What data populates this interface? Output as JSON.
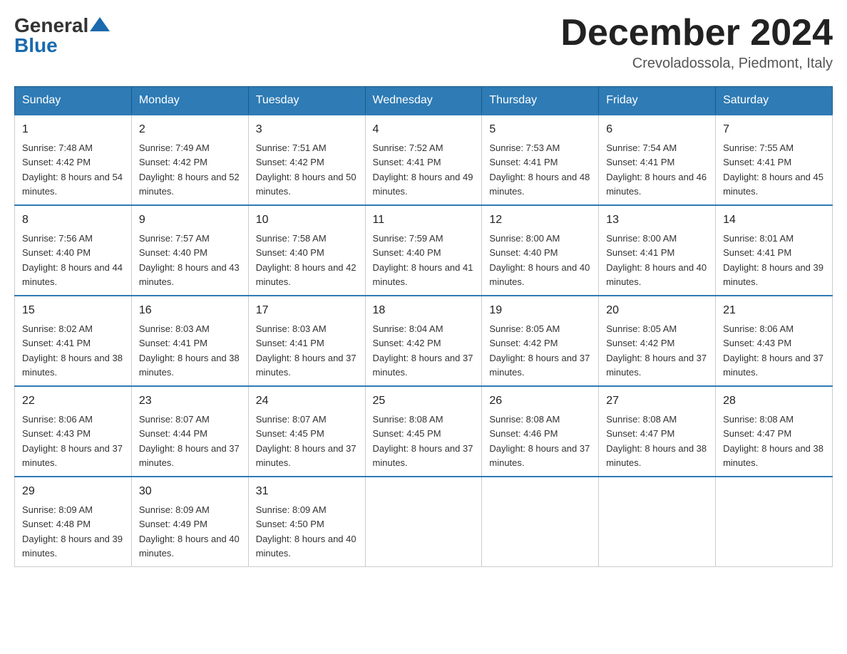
{
  "logo": {
    "general": "General",
    "blue": "Blue"
  },
  "title": "December 2024",
  "location": "Crevoladossola, Piedmont, Italy",
  "days_of_week": [
    "Sunday",
    "Monday",
    "Tuesday",
    "Wednesday",
    "Thursday",
    "Friday",
    "Saturday"
  ],
  "weeks": [
    [
      {
        "day": "1",
        "sunrise": "7:48 AM",
        "sunset": "4:42 PM",
        "daylight": "8 hours and 54 minutes."
      },
      {
        "day": "2",
        "sunrise": "7:49 AM",
        "sunset": "4:42 PM",
        "daylight": "8 hours and 52 minutes."
      },
      {
        "day": "3",
        "sunrise": "7:51 AM",
        "sunset": "4:42 PM",
        "daylight": "8 hours and 50 minutes."
      },
      {
        "day": "4",
        "sunrise": "7:52 AM",
        "sunset": "4:41 PM",
        "daylight": "8 hours and 49 minutes."
      },
      {
        "day": "5",
        "sunrise": "7:53 AM",
        "sunset": "4:41 PM",
        "daylight": "8 hours and 48 minutes."
      },
      {
        "day": "6",
        "sunrise": "7:54 AM",
        "sunset": "4:41 PM",
        "daylight": "8 hours and 46 minutes."
      },
      {
        "day": "7",
        "sunrise": "7:55 AM",
        "sunset": "4:41 PM",
        "daylight": "8 hours and 45 minutes."
      }
    ],
    [
      {
        "day": "8",
        "sunrise": "7:56 AM",
        "sunset": "4:40 PM",
        "daylight": "8 hours and 44 minutes."
      },
      {
        "day": "9",
        "sunrise": "7:57 AM",
        "sunset": "4:40 PM",
        "daylight": "8 hours and 43 minutes."
      },
      {
        "day": "10",
        "sunrise": "7:58 AM",
        "sunset": "4:40 PM",
        "daylight": "8 hours and 42 minutes."
      },
      {
        "day": "11",
        "sunrise": "7:59 AM",
        "sunset": "4:40 PM",
        "daylight": "8 hours and 41 minutes."
      },
      {
        "day": "12",
        "sunrise": "8:00 AM",
        "sunset": "4:40 PM",
        "daylight": "8 hours and 40 minutes."
      },
      {
        "day": "13",
        "sunrise": "8:00 AM",
        "sunset": "4:41 PM",
        "daylight": "8 hours and 40 minutes."
      },
      {
        "day": "14",
        "sunrise": "8:01 AM",
        "sunset": "4:41 PM",
        "daylight": "8 hours and 39 minutes."
      }
    ],
    [
      {
        "day": "15",
        "sunrise": "8:02 AM",
        "sunset": "4:41 PM",
        "daylight": "8 hours and 38 minutes."
      },
      {
        "day": "16",
        "sunrise": "8:03 AM",
        "sunset": "4:41 PM",
        "daylight": "8 hours and 38 minutes."
      },
      {
        "day": "17",
        "sunrise": "8:03 AM",
        "sunset": "4:41 PM",
        "daylight": "8 hours and 37 minutes."
      },
      {
        "day": "18",
        "sunrise": "8:04 AM",
        "sunset": "4:42 PM",
        "daylight": "8 hours and 37 minutes."
      },
      {
        "day": "19",
        "sunrise": "8:05 AM",
        "sunset": "4:42 PM",
        "daylight": "8 hours and 37 minutes."
      },
      {
        "day": "20",
        "sunrise": "8:05 AM",
        "sunset": "4:42 PM",
        "daylight": "8 hours and 37 minutes."
      },
      {
        "day": "21",
        "sunrise": "8:06 AM",
        "sunset": "4:43 PM",
        "daylight": "8 hours and 37 minutes."
      }
    ],
    [
      {
        "day": "22",
        "sunrise": "8:06 AM",
        "sunset": "4:43 PM",
        "daylight": "8 hours and 37 minutes."
      },
      {
        "day": "23",
        "sunrise": "8:07 AM",
        "sunset": "4:44 PM",
        "daylight": "8 hours and 37 minutes."
      },
      {
        "day": "24",
        "sunrise": "8:07 AM",
        "sunset": "4:45 PM",
        "daylight": "8 hours and 37 minutes."
      },
      {
        "day": "25",
        "sunrise": "8:08 AM",
        "sunset": "4:45 PM",
        "daylight": "8 hours and 37 minutes."
      },
      {
        "day": "26",
        "sunrise": "8:08 AM",
        "sunset": "4:46 PM",
        "daylight": "8 hours and 37 minutes."
      },
      {
        "day": "27",
        "sunrise": "8:08 AM",
        "sunset": "4:47 PM",
        "daylight": "8 hours and 38 minutes."
      },
      {
        "day": "28",
        "sunrise": "8:08 AM",
        "sunset": "4:47 PM",
        "daylight": "8 hours and 38 minutes."
      }
    ],
    [
      {
        "day": "29",
        "sunrise": "8:09 AM",
        "sunset": "4:48 PM",
        "daylight": "8 hours and 39 minutes."
      },
      {
        "day": "30",
        "sunrise": "8:09 AM",
        "sunset": "4:49 PM",
        "daylight": "8 hours and 40 minutes."
      },
      {
        "day": "31",
        "sunrise": "8:09 AM",
        "sunset": "4:50 PM",
        "daylight": "8 hours and 40 minutes."
      },
      null,
      null,
      null,
      null
    ]
  ],
  "labels": {
    "sunrise": "Sunrise:",
    "sunset": "Sunset:",
    "daylight": "Daylight:"
  }
}
